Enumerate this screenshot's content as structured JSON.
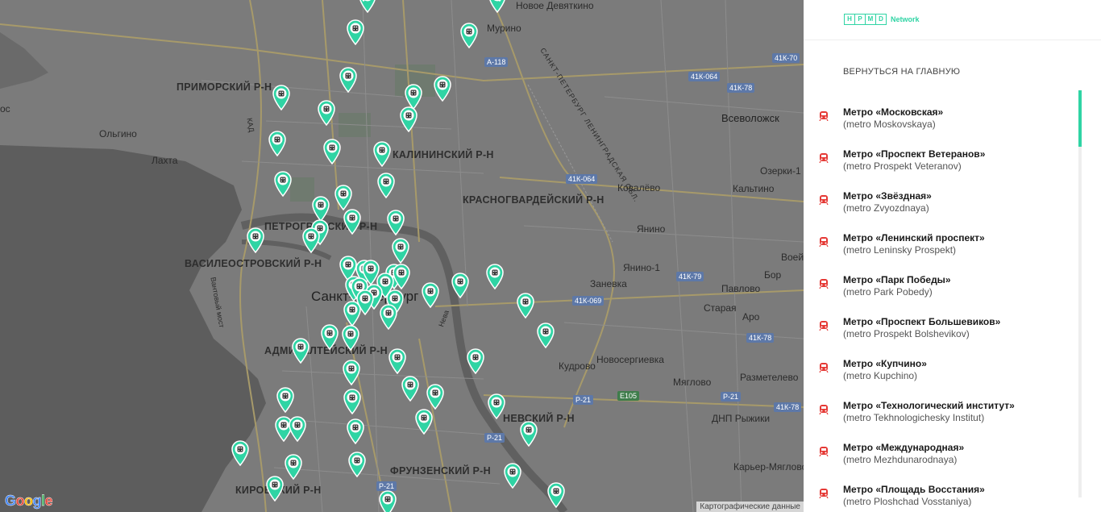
{
  "panel": {
    "logo_letters": [
      "Н",
      "Р",
      "М",
      "D"
    ],
    "logo_network": "Network",
    "back_link": "ВЕРНУТЬСЯ НА ГЛАВНУЮ",
    "accent_color": "#2fd4a4",
    "metro_icon": "metro-train-icon",
    "items": [
      {
        "title": "Метро «Московская»",
        "sub": "(metro Moskovskaya)"
      },
      {
        "title": "Метро «Проспект Ветеранов»",
        "sub": "(metro Prospekt Veteranov)"
      },
      {
        "title": "Метро «Звёздная»",
        "sub": "(metro Zvyozdnaya)"
      },
      {
        "title": "Метро «Ленинский проспект»",
        "sub": "(metro Leninsky Prospekt)"
      },
      {
        "title": "Метро «Парк Победы»",
        "sub": "(metro Park Pobedy)"
      },
      {
        "title": "Метро «Проспект Большевиков»",
        "sub": "(metro Prospekt Bolshevikov)"
      },
      {
        "title": "Метро «Купчино»",
        "sub": "(metro Kupchino)"
      },
      {
        "title": "Метро «Технологический институт»",
        "sub": "(metro Tekhnologichesky Institut)"
      },
      {
        "title": "Метро «Международная»",
        "sub": "(metro Mezhdunarodnaya)"
      },
      {
        "title": "Метро «Площадь Восстания»",
        "sub": "(metro Ploshchad Vosstaniya)"
      }
    ]
  },
  "map": {
    "labels": {
      "devyatkino": "Новое Девяткино",
      "murino": "Мурино",
      "primorsky": "ПРИМОРСКИЙ Р-Н",
      "olgino": "Ольгино",
      "lakhta": "Лахта",
      "kalininsky": "КАЛИНИНСКИЙ Р-Н",
      "krasnogvard": "КРАСНОГВАРДЕЙСКИЙ Р-Н",
      "petrograd": "ПЕТРОГРАДСКИЙ Р-Н",
      "vasileostrov": "ВАСИЛЕОСТРОВСКИЙ Р-Н",
      "spb": "Санкт-Петербург",
      "admiralt": "АДМИРАЛТЕЙСКИЙ Р-Н",
      "vsevolozhsk": "Всеволожск",
      "ozerki": "Озерки-1",
      "kovalevo": "Ковалёво",
      "kaltino": "Кальтино",
      "yanino": "Янино",
      "yanino1": "Янино-1",
      "voeyk": "Воейк",
      "zanevka": "Заневка",
      "bor": "Бор",
      "pavlovo": "Павлово",
      "staraya": "Старая",
      "aro": "Аро",
      "novosergievka": "Новосергиевка",
      "kudrovo": "Кудрово",
      "myaglovo": "Мяглово",
      "razmetelevo": "Разметелево",
      "nevsky": "НЕВСКИЙ Р-Н",
      "dnp": "ДНП Рыжики",
      "karier": "Карьер-Мяглово",
      "frunzensky": "ФРУНЗЕНСКИЙ Р-Н",
      "kirovsky": "КИРОВСКИЙ Р-Н",
      "neva": "Нева",
      "ring": "КАД",
      "vantovy": "Вантовый мост",
      "oblast": "САНКТ-ПЕТЕРБУРГ ЛЕНИНГРАДСКАЯ ОБЛ.",
      "os": "ос"
    },
    "roads": {
      "a118": "А-118",
      "k70": "41К-70",
      "k064a": "41К-064",
      "k78a": "41К-78",
      "k064b": "41К-064",
      "k79": "41К-79",
      "k069": "41К-069",
      "k78b": "41К-78",
      "p21a": "Р-21",
      "e105": "E105",
      "p21b": "Р-21",
      "k78c": "41К-78",
      "p21c": "Р-21",
      "p21d": "Р-21"
    },
    "copyright": "Картографические данные",
    "google_letters": [
      "G",
      "o",
      "o",
      "g",
      "l",
      "e"
    ],
    "pin_color": "#2fd4a4",
    "pin_count": 66
  }
}
